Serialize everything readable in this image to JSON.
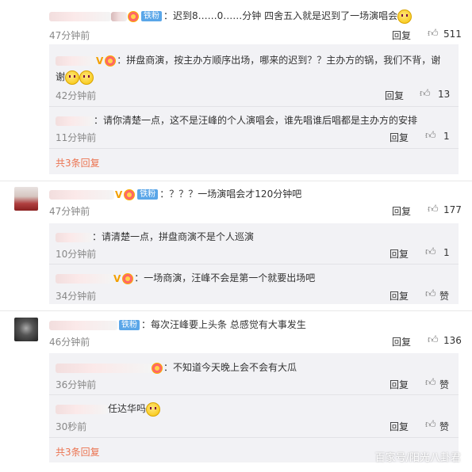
{
  "comments": [
    {
      "text": "：迟到8……0……分钟  四舍五入就是迟到了一场演唱会",
      "badge": "铁粉",
      "time": "47分钟前",
      "reply_label": "回复",
      "likes": "511",
      "replies": [
        {
          "text": "：拼盘商演，按主办方顺序出场，哪来的迟到？？主办方的锅，我们不背，谢",
          "text2": "谢",
          "time": "42分钟前",
          "reply_label": "回复",
          "likes": "13"
        },
        {
          "text": "：请你清楚一点，这不是汪峰的个人演唱会，谁先唱谁后唱都是主办方的安排",
          "time": "11分钟前",
          "reply_label": "回复",
          "likes": "1"
        }
      ],
      "more": "共3条回复"
    },
    {
      "text": "：？？？一场演唱会才120分钟吧",
      "badge": "铁粉",
      "time": "47分钟前",
      "reply_label": "回复",
      "likes": "177",
      "replies": [
        {
          "text": "：请清楚一点，拼盘商演不是个人巡演",
          "time": "10分钟前",
          "reply_label": "回复",
          "likes": "1"
        },
        {
          "text": "：一场商演，汪峰不会是第一个就要出场吧",
          "time": "34分钟前",
          "reply_label": "回复",
          "likes": "赞"
        }
      ]
    },
    {
      "text": "：每次汪峰要上头条 总感觉有大事发生",
      "badge": "铁粉",
      "time": "46分钟前",
      "reply_label": "回复",
      "likes": "136",
      "replies": [
        {
          "text": "：不知道今天晚上会不会有大瓜",
          "time": "36分钟前",
          "reply_label": "回复",
          "likes": "赞"
        },
        {
          "text": "任达华吗",
          "time": "30秒前",
          "reply_label": "回复",
          "likes": "赞"
        }
      ],
      "more": "共3条回复"
    }
  ],
  "watermark": "百家号/阳光八卦君",
  "icons": {
    "like": "thumbs-up-icon",
    "verified": "v-badge-icon",
    "medal": "medal-icon",
    "emoji": "smile-emoji-icon"
  },
  "colors": {
    "more_link": "#eb7350",
    "fan_badge": "#5aa6e8",
    "reply_bg": "#f2f2f5"
  }
}
